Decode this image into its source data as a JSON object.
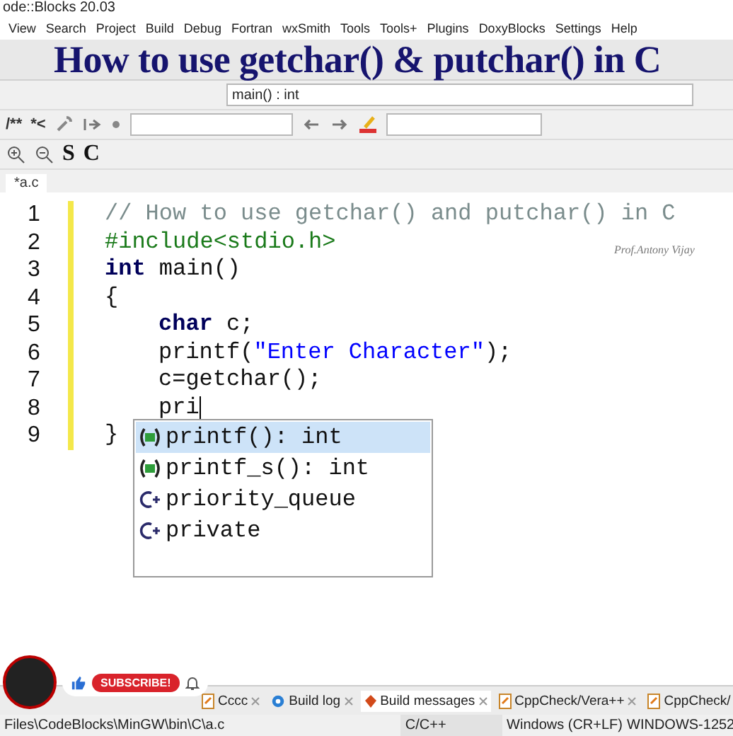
{
  "window": {
    "title": "ode::Blocks 20.03"
  },
  "menu": [
    "View",
    "Search",
    "Project",
    "Build",
    "Debug",
    "Fortran",
    "wxSmith",
    "Tools",
    "Tools+",
    "Plugins",
    "DoxyBlocks",
    "Settings",
    "Help"
  ],
  "video_title": "How to use getchar() & putchar() in C",
  "scope_box": {
    "value": "main() : int"
  },
  "toolbar_texts": [
    "/**",
    "*<"
  ],
  "format_buttons": [
    "S",
    "C"
  ],
  "file_tabs": [
    {
      "label": "*a.c",
      "selected": true
    }
  ],
  "credit": "Prof.Antony Vijay",
  "code_lines": [
    {
      "number": "1",
      "indent": false,
      "cursor": false,
      "tokens": [
        {
          "kind": "comment",
          "text": "// How to use getchar() and putchar() in C"
        }
      ]
    },
    {
      "number": "2",
      "indent": false,
      "cursor": false,
      "tokens": [
        {
          "kind": "preproc",
          "text": "#include<stdio.h>"
        }
      ]
    },
    {
      "number": "3",
      "indent": false,
      "cursor": false,
      "tokens": [
        {
          "kind": "keyword",
          "text": "int"
        },
        {
          "kind": "plain",
          "text": " main()"
        }
      ]
    },
    {
      "number": "4",
      "indent": false,
      "cursor": false,
      "tokens": [
        {
          "kind": "plain",
          "text": "{"
        }
      ]
    },
    {
      "number": "5",
      "indent": true,
      "cursor": false,
      "tokens": [
        {
          "kind": "keyword",
          "text": "char"
        },
        {
          "kind": "plain",
          "text": " c;"
        }
      ]
    },
    {
      "number": "6",
      "indent": true,
      "cursor": false,
      "tokens": [
        {
          "kind": "plain",
          "text": "printf("
        },
        {
          "kind": "string",
          "text": "\"Enter Character\""
        },
        {
          "kind": "plain",
          "text": ");"
        }
      ]
    },
    {
      "number": "7",
      "indent": true,
      "cursor": false,
      "tokens": [
        {
          "kind": "plain",
          "text": "c=getchar();"
        }
      ]
    },
    {
      "number": "8",
      "indent": true,
      "cursor": true,
      "tokens": [
        {
          "kind": "plain",
          "text": "pri"
        }
      ]
    },
    {
      "number": "9",
      "indent": false,
      "cursor": false,
      "tokens": [
        {
          "kind": "plain",
          "text": "}"
        }
      ]
    }
  ],
  "autocomplete": [
    {
      "kind": "function",
      "label": "printf(): int",
      "selected": true
    },
    {
      "kind": "function",
      "label": "printf_s(): int",
      "selected": false
    },
    {
      "kind": "class",
      "label": "priority_queue",
      "selected": false
    },
    {
      "kind": "class",
      "label": "private",
      "selected": false
    }
  ],
  "subscribe": {
    "label": "SUBSCRIBE!"
  },
  "log_tabs": [
    {
      "label": "Cccc",
      "selected": false
    },
    {
      "label": "Build log",
      "selected": false
    },
    {
      "label": "Build messages",
      "selected": true
    },
    {
      "label": "CppCheck/Vera++",
      "selected": false
    },
    {
      "label": "CppCheck/",
      "selected": false
    }
  ],
  "status_bar": {
    "path": "Files\\CodeBlocks\\MinGW\\bin\\C\\a.c",
    "language": "C/C++",
    "line_endings": "Windows (CR+LF)",
    "encoding": "WINDOWS-1252"
  }
}
